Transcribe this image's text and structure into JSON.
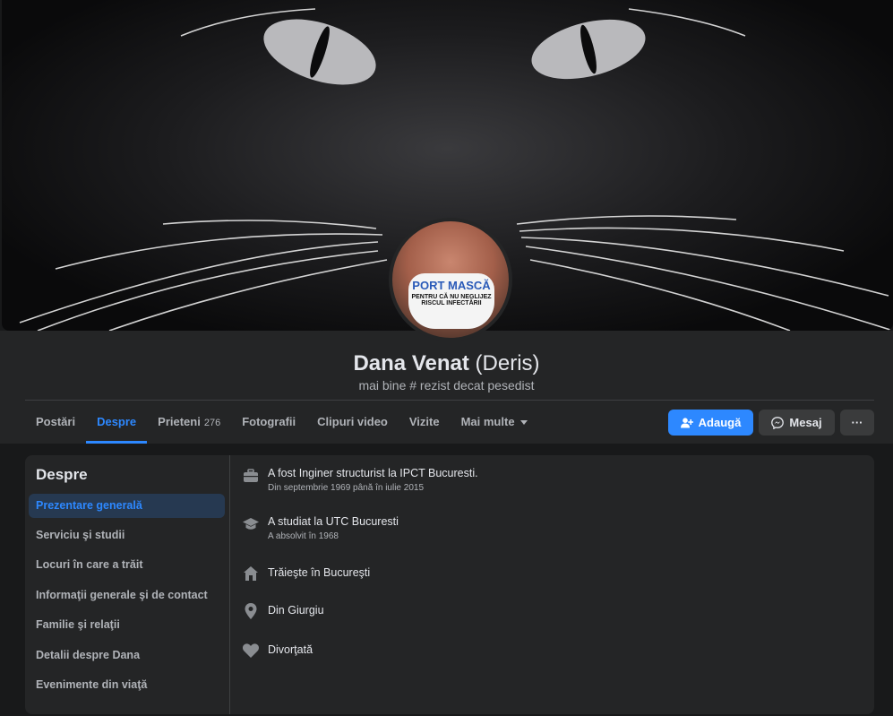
{
  "profile": {
    "name": "Dana Venat",
    "alt_name": "(Deris)",
    "bio": "mai bine # rezist decat pesedist",
    "avatar_mask": {
      "line1": "PORT MASCĂ",
      "line2": "PENTRU CĂ NU NEGLIJEZ",
      "line3": "RISCUL INFECTĂRII"
    }
  },
  "tabs": [
    {
      "label": "Postări",
      "count": ""
    },
    {
      "label": "Despre",
      "count": ""
    },
    {
      "label": "Prieteni",
      "count": "276"
    },
    {
      "label": "Fotografii",
      "count": ""
    },
    {
      "label": "Clipuri video",
      "count": ""
    },
    {
      "label": "Vizite",
      "count": ""
    },
    {
      "label": "Mai multe",
      "count": ""
    }
  ],
  "actions": {
    "add": "Adaugă",
    "message": "Mesaj",
    "more": "···"
  },
  "about": {
    "title": "Despre",
    "menu": [
      "Prezentare generală",
      "Serviciu şi studii",
      "Locuri în care a trăit",
      "Informaţii generale şi de contact",
      "Familie şi relaţii",
      "Detalii despre Dana",
      "Evenimente din viaţă"
    ],
    "items": [
      {
        "icon": "briefcase-icon",
        "text": "A fost Inginer structurist la IPCT Bucuresti.",
        "sub": "Din septembrie 1969 până în iulie 2015"
      },
      {
        "icon": "graduation-cap-icon",
        "text": "A studiat la UTC Bucuresti",
        "sub": "A absolvit în 1968"
      },
      {
        "icon": "home-icon",
        "text": "Trăieşte în Bucureşti",
        "sub": ""
      },
      {
        "icon": "location-pin-icon",
        "text": "Din Giurgiu",
        "sub": ""
      },
      {
        "icon": "heart-icon",
        "text": "Divorţată",
        "sub": ""
      }
    ]
  },
  "colors": {
    "accent": "#2d88ff",
    "panel": "#242526",
    "background": "#18191a"
  }
}
